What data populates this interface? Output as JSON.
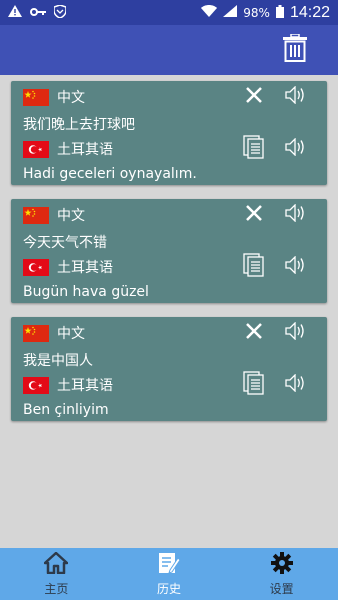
{
  "status_bar": {
    "battery": "98%",
    "time": "14:22"
  },
  "app_bar": {
    "delete_icon": "trash-icon"
  },
  "history": [
    {
      "source_lang": "中文",
      "source_text": "我们晚上去打球吧",
      "target_lang": "土耳其语",
      "target_text": "Hadi geceleri oynayalım."
    },
    {
      "source_lang": "中文",
      "source_text": "今天天气不错",
      "target_lang": "土耳其语",
      "target_text": "Bugün hava güzel"
    },
    {
      "source_lang": "中文",
      "source_text": "我是中国人",
      "target_lang": "土耳其语",
      "target_text": "Ben çinliyim"
    }
  ],
  "bottom_nav": {
    "items": [
      {
        "label": "主页",
        "icon": "home-icon",
        "active": false
      },
      {
        "label": "历史",
        "icon": "history-icon",
        "active": true
      },
      {
        "label": "设置",
        "icon": "gear-icon",
        "active": false
      }
    ]
  },
  "colors": {
    "status_bar": "#2e3fa0",
    "app_bar": "#3f51b5",
    "card": "#5a8484",
    "bottom_nav": "#5fa8e8",
    "nav_active": "#ffffff",
    "nav_inactive": "#2d3a4a"
  }
}
